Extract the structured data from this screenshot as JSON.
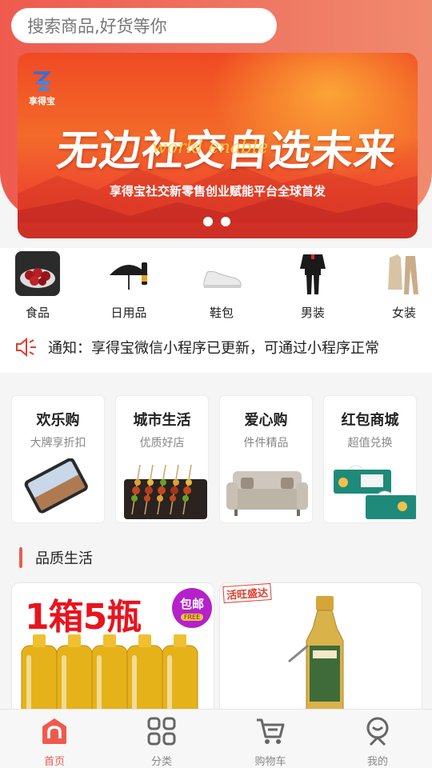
{
  "search": {
    "placeholder": "搜索商品,好货等你"
  },
  "banner": {
    "logo_text": "享得宝",
    "title": "无边社交自选未来",
    "script_text": "world enable",
    "subtitle": "享得宝社交新零售创业赋能平台全球首发",
    "page_count": 2
  },
  "categories": [
    {
      "label": "食品",
      "icon": "dates-fruit-icon"
    },
    {
      "label": "日用品",
      "icon": "umbrella-icon"
    },
    {
      "label": "鞋包",
      "icon": "sneaker-icon"
    },
    {
      "label": "男装",
      "icon": "mens-tracksuit-icon"
    },
    {
      "label": "女装",
      "icon": "womens-suit-icon"
    }
  ],
  "notice": {
    "text": "通知：享得宝微信小程序已更新，可通过小程序正常"
  },
  "promos": [
    {
      "title": "欢乐购",
      "subtitle": "大牌享折扣",
      "icon": "smartphone-icon"
    },
    {
      "title": "城市生活",
      "subtitle": "优质好店",
      "icon": "skewers-icon"
    },
    {
      "title": "爱心购",
      "subtitle": "件件精品",
      "icon": "sofa-icon"
    },
    {
      "title": "红包商城",
      "subtitle": "超值兑换",
      "icon": "tissue-box-icon"
    }
  ],
  "section": {
    "title": "品质生活"
  },
  "products": [
    {
      "headline": "1箱5瓶",
      "badge": "包邮",
      "badge_sub": "FREE",
      "icon": "oil-bottles-icon"
    },
    {
      "tag": "活旺盛达",
      "icon": "camellia-oil-bottle-icon"
    }
  ],
  "tabbar": [
    {
      "label": "首页",
      "icon": "home-icon",
      "active": true
    },
    {
      "label": "分类",
      "icon": "grid-icon",
      "active": false
    },
    {
      "label": "购物车",
      "icon": "cart-icon",
      "active": false
    },
    {
      "label": "我的",
      "icon": "profile-icon",
      "active": false
    }
  ],
  "colors": {
    "accent": "#ee5b4e",
    "banner": "#f04a22",
    "headline_red": "#e8141e"
  }
}
